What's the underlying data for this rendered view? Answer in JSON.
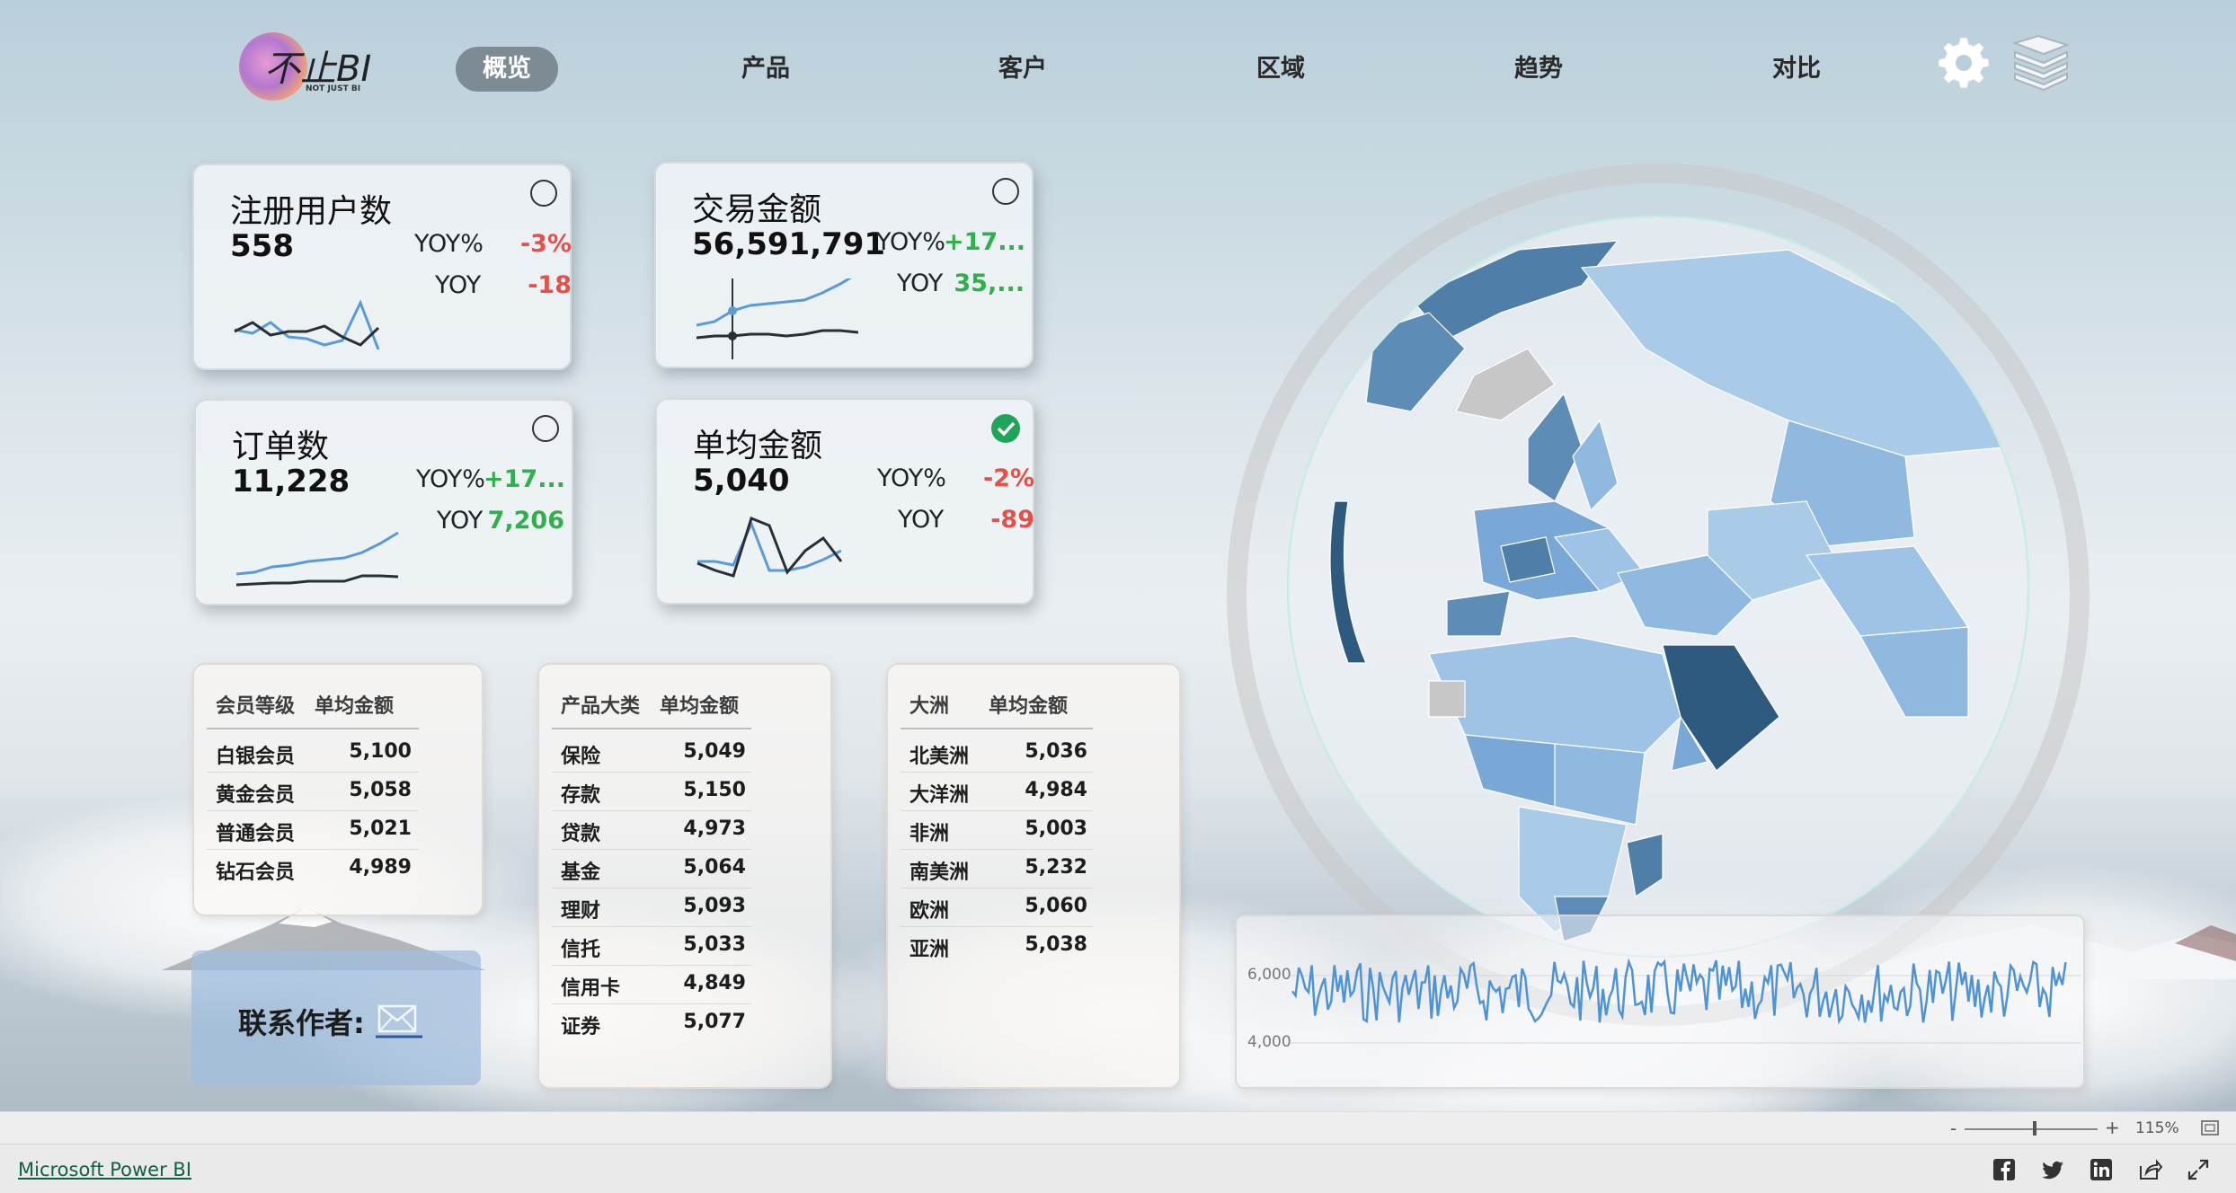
{
  "logo": {
    "text": "不止BI",
    "tagline": "NOT JUST BI"
  },
  "nav": {
    "items": [
      {
        "label": "概览",
        "active": true
      },
      {
        "label": "产品",
        "active": false
      },
      {
        "label": "客户",
        "active": false
      },
      {
        "label": "区域",
        "active": false
      },
      {
        "label": "趋势",
        "active": false
      },
      {
        "label": "对比",
        "active": false
      }
    ],
    "icons": [
      "gear-icon",
      "layers-icon"
    ]
  },
  "kpis": [
    {
      "title": "注册用户数",
      "value": "558",
      "yoy_pct_label": "YOY%",
      "yoy_pct": "-3%",
      "yoy_label": "YOY",
      "yoy": "-18",
      "selected": false
    },
    {
      "title": "交易金额",
      "value": "56,591,791",
      "yoy_pct_label": "YOY%",
      "yoy_pct": "+17...",
      "yoy_label": "YOY",
      "yoy": "35,...",
      "selected": false
    },
    {
      "title": "订单数",
      "value": "11,228",
      "yoy_pct_label": "YOY%",
      "yoy_pct": "+17...",
      "yoy_label": "YOY",
      "yoy": "7,206",
      "selected": false
    },
    {
      "title": "单均金额",
      "value": "5,040",
      "yoy_pct_label": "YOY%",
      "yoy_pct": "-2%",
      "yoy_label": "YOY",
      "yoy": "-89",
      "selected": true
    }
  ],
  "tables": {
    "membership": {
      "headers": [
        "会员等级",
        "单均金额"
      ],
      "rows": [
        [
          "白银会员",
          "5,100"
        ],
        [
          "黄金会员",
          "5,058"
        ],
        [
          "普通会员",
          "5,021"
        ],
        [
          "钻石会员",
          "4,989"
        ]
      ]
    },
    "product": {
      "headers": [
        "产品大类",
        "单均金额"
      ],
      "rows": [
        [
          "保险",
          "5,049"
        ],
        [
          "存款",
          "5,150"
        ],
        [
          "贷款",
          "4,973"
        ],
        [
          "基金",
          "5,064"
        ],
        [
          "理财",
          "5,093"
        ],
        [
          "信托",
          "5,033"
        ],
        [
          "信用卡",
          "4,849"
        ],
        [
          "证券",
          "5,077"
        ]
      ]
    },
    "continent": {
      "headers": [
        "大洲",
        "单均金额"
      ],
      "rows": [
        [
          "北美洲",
          "5,036"
        ],
        [
          "大洋洲",
          "4,984"
        ],
        [
          "非洲",
          "5,003"
        ],
        [
          "南美洲",
          "5,232"
        ],
        [
          "欧洲",
          "5,060"
        ],
        [
          "亚洲",
          "5,038"
        ]
      ]
    }
  },
  "contact": {
    "label": "联系作者:"
  },
  "linechart": {
    "y_ticks": [
      "6,000",
      "4,000"
    ]
  },
  "zoom": {
    "minus": "-",
    "plus": "+",
    "percent": "115%"
  },
  "footer": {
    "link": "Microsoft Power BI",
    "social": [
      "facebook-icon",
      "twitter-icon",
      "linkedin-icon",
      "share-icon",
      "expand-icon"
    ]
  },
  "colors": {
    "accent_blue": "#5b9bd5",
    "dark_line": "#2b2f33",
    "red": "#e5504a",
    "green": "#2fb04c",
    "nav_active": "#7d8b95"
  }
}
